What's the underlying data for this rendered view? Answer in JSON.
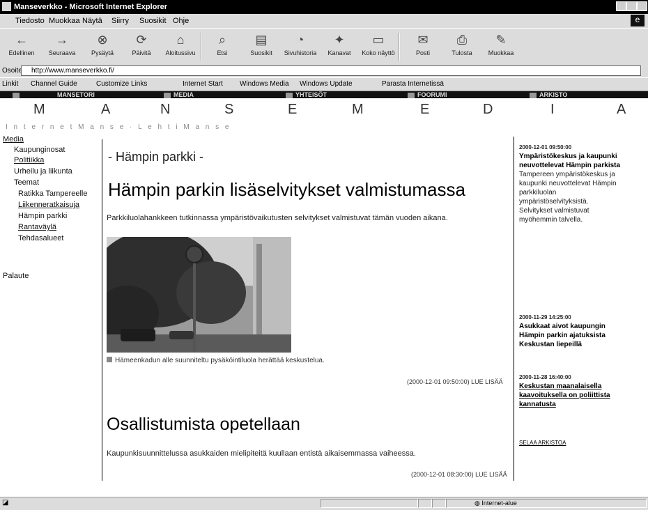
{
  "window": {
    "title": "Manseverkko - Microsoft Internet Explorer"
  },
  "menu": {
    "items": [
      "Tiedosto",
      "Muokkaa",
      "Näytä",
      "Siirry",
      "Suosikit",
      "Ohje"
    ]
  },
  "toolbar": {
    "buttons": [
      {
        "label": "Edellinen",
        "icon": "back-arrow-icon"
      },
      {
        "label": "Seuraava",
        "icon": "forward-arrow-icon"
      },
      {
        "label": "Pysäytä",
        "icon": "stop-icon"
      },
      {
        "label": "Päivitä",
        "icon": "refresh-icon"
      },
      {
        "label": "Aloitussivu",
        "icon": "home-icon"
      },
      {
        "label": "Etsi",
        "icon": "search-icon"
      },
      {
        "label": "Suosikit",
        "icon": "favorites-icon"
      },
      {
        "label": "Sivuhistoria",
        "icon": "history-icon"
      },
      {
        "label": "Kanavat",
        "icon": "channels-icon"
      },
      {
        "label": "Koko näyttö",
        "icon": "fullscreen-icon"
      },
      {
        "label": "Posti",
        "icon": "mail-icon"
      },
      {
        "label": "Tulosta",
        "icon": "print-icon"
      },
      {
        "label": "Muokkaa",
        "icon": "edit-icon"
      }
    ]
  },
  "address": {
    "label": "Osoite",
    "value": "http://www.manseverkko.fi/"
  },
  "links": {
    "items": [
      "Linkit",
      "Channel Guide",
      "Customize Links",
      "Internet Start",
      "Windows Media",
      "Windows Update",
      "Parasta Internetissä"
    ]
  },
  "sitenav": {
    "items": [
      "MANSETORI",
      "MEDIA",
      "YHTEISÖT",
      "FOORUMI",
      "ARKISTO"
    ]
  },
  "brand": {
    "letters": [
      "M",
      "A",
      "N",
      "S",
      "E",
      "M",
      "E",
      "D",
      "I",
      "A"
    ],
    "subnav": "I n t e r n e t   M a n s e  ·  L e h t i   M a n s e"
  },
  "leftnav": {
    "items": [
      {
        "label": "Media",
        "link": true
      },
      {
        "label": "Kaupunginosat",
        "link": false
      },
      {
        "label": "Politiikka",
        "link": true
      },
      {
        "label": "Urheilu ja liikunta",
        "link": false
      },
      {
        "label": "Teemat",
        "link": false
      },
      {
        "label": "Ratikka Tampereelle",
        "link": false
      },
      {
        "label": "Liikenneratkaisuja",
        "link": true
      },
      {
        "label": "Hämpin parkki",
        "link": false
      },
      {
        "label": "Rantaväylä",
        "link": true
      },
      {
        "label": "Tehdasalueet",
        "link": false
      },
      {
        "label": "Palaute",
        "link": false
      }
    ]
  },
  "main": {
    "section": "- Hämpin parkki -",
    "headline": "Hämpin parkin lisäselvitykset valmistumassa",
    "lead": "Parkkiluolahankkeen tutkinnassa ympäristövaikutusten selvitykset valmistuvat tämän vuoden aikana.",
    "photo_alt": "Hämeenkadun varrelta kuvattu katunäkymä",
    "caption": "Hämeenkadun alle suunniteltu pysäköintiluola herättää keskustelua.",
    "meta1": "(2000-12-01 09:50:00) LUE LISÄÄ",
    "headline2": "Osallistumista opetellaan",
    "lead2": "Kaupunkisuunnittelussa asukkaiden mielipiteitä kuullaan entistä aikaisemmassa vaiheessa.",
    "meta2": "(2000-12-01 08:30:00) LUE LISÄÄ"
  },
  "rightcol": {
    "items": [
      {
        "date": "2000-12-01 09:50:00",
        "headline": "Ympäristökeskus ja kaupunki neuvottelevat Hämpin parkista",
        "body": "Tampereen ympäristökeskus ja kaupunki neuvottelevat Hämpin parkkiluolan ympäristöselvityksistä. Selvitykset valmistuvat myöhemmin talvella."
      },
      {
        "date": "2000-11-29 14:25:00",
        "headline": "Asukkaat aivot kaupungin Hämpin parkin ajatuksista Keskustan liepeillä",
        "body": ""
      },
      {
        "date": "2000-11-28 16:40:00",
        "headline": "Keskustan maanalaisella kaavoituksella on poliittista kannatusta",
        "body": ""
      },
      {
        "date": "",
        "headline": "SELAA ARKISTOA",
        "body": ""
      }
    ]
  },
  "status": {
    "text": "",
    "zone": "Internet-alue"
  }
}
